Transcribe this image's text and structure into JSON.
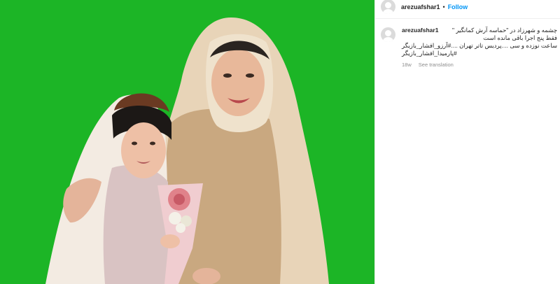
{
  "post": {
    "username": "arezuafshar1",
    "separator": "•",
    "follow_label": "Follow"
  },
  "caption": {
    "username": "arezuafshar1",
    "lines": [
      "چشمه و شهرزاد در \"حماسه آرش کمانگیر \"",
      "فقط پنج اجرا باقی مانده است",
      "ساعت نوزده و سی ....پردیس تاتر تهران ....#آرزو_افشار_بازیگر",
      "#پارمیدا_افشار_بازیگر"
    ],
    "age": "18w",
    "translate_label": "See translation"
  },
  "media": {
    "description_icon": "photo-icon",
    "background_color": "#1bb524"
  }
}
